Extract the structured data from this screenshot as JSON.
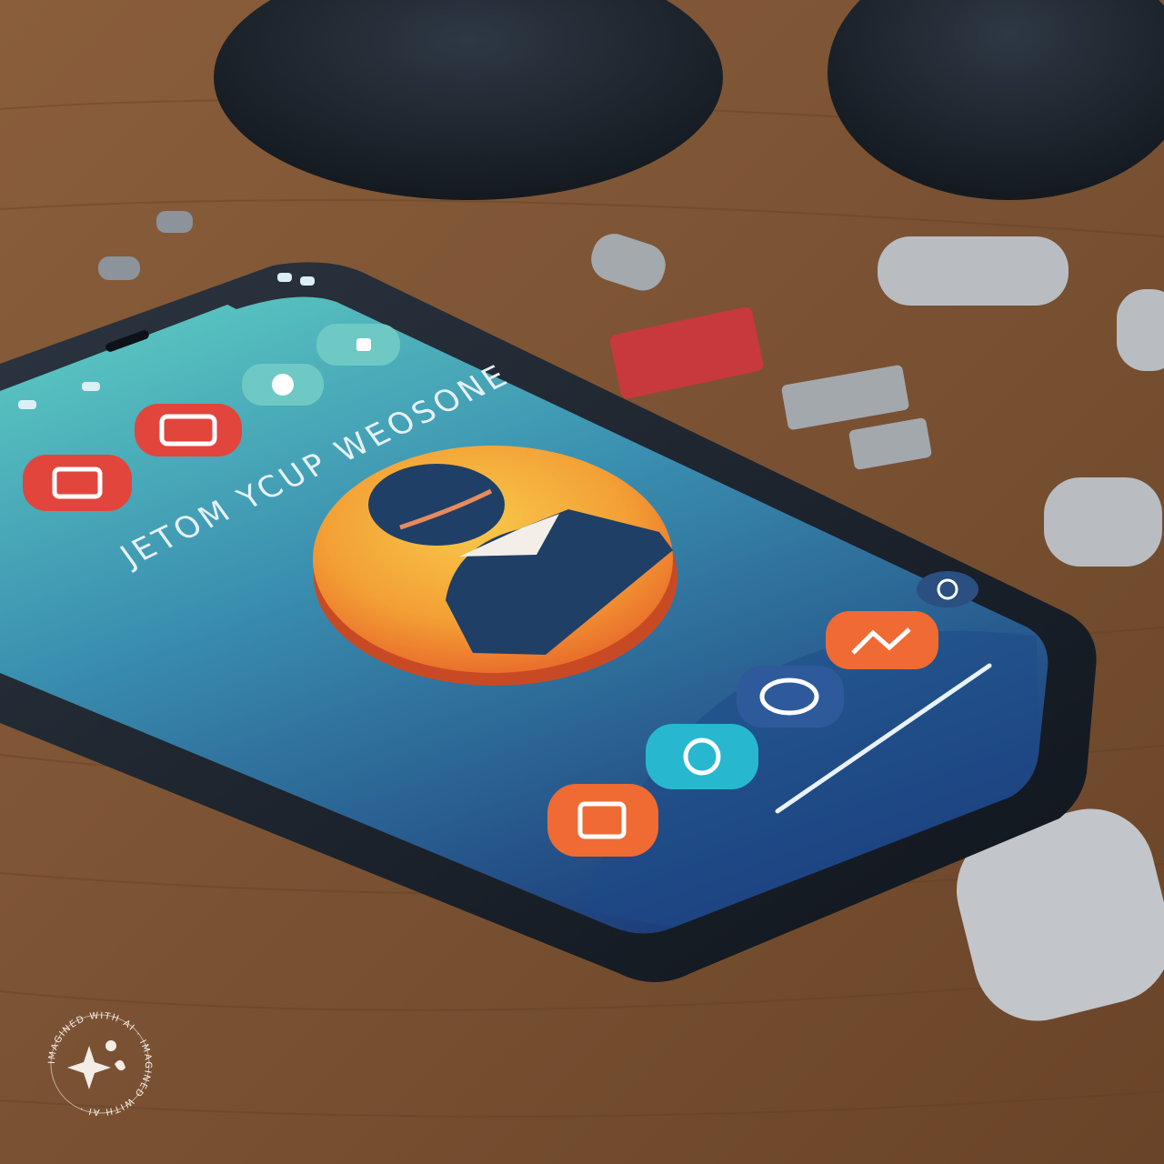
{
  "screen": {
    "headline": "JETOM YCUP WEOSONE"
  },
  "watermark": {
    "text": "IMAGINED WITH AI · IMAGINED WITH AI ·"
  },
  "colors": {
    "wood": "#7a5233",
    "wood_light": "#9c7049",
    "phone_frame": "#1b2430",
    "screen_top": "#54c3c1",
    "screen_bottom": "#214b86",
    "avatar_yellow": "#f6b93b",
    "avatar_orange": "#ec6a2b",
    "figure_navy": "#1f3f66",
    "app_red": "#e2453c",
    "app_orange": "#f06a33",
    "app_teal": "#27b8cf",
    "app_blue": "#2e5a9c",
    "pebble": "#b9bdc2",
    "block_red": "#c7393b"
  },
  "icons": [
    "profile-avatar-icon",
    "camera-app-icon",
    "chat-app-icon",
    "photo-app-icon",
    "clock-app-icon",
    "refresh-icon",
    "gallery-app-icon",
    "sparkle-icon"
  ]
}
